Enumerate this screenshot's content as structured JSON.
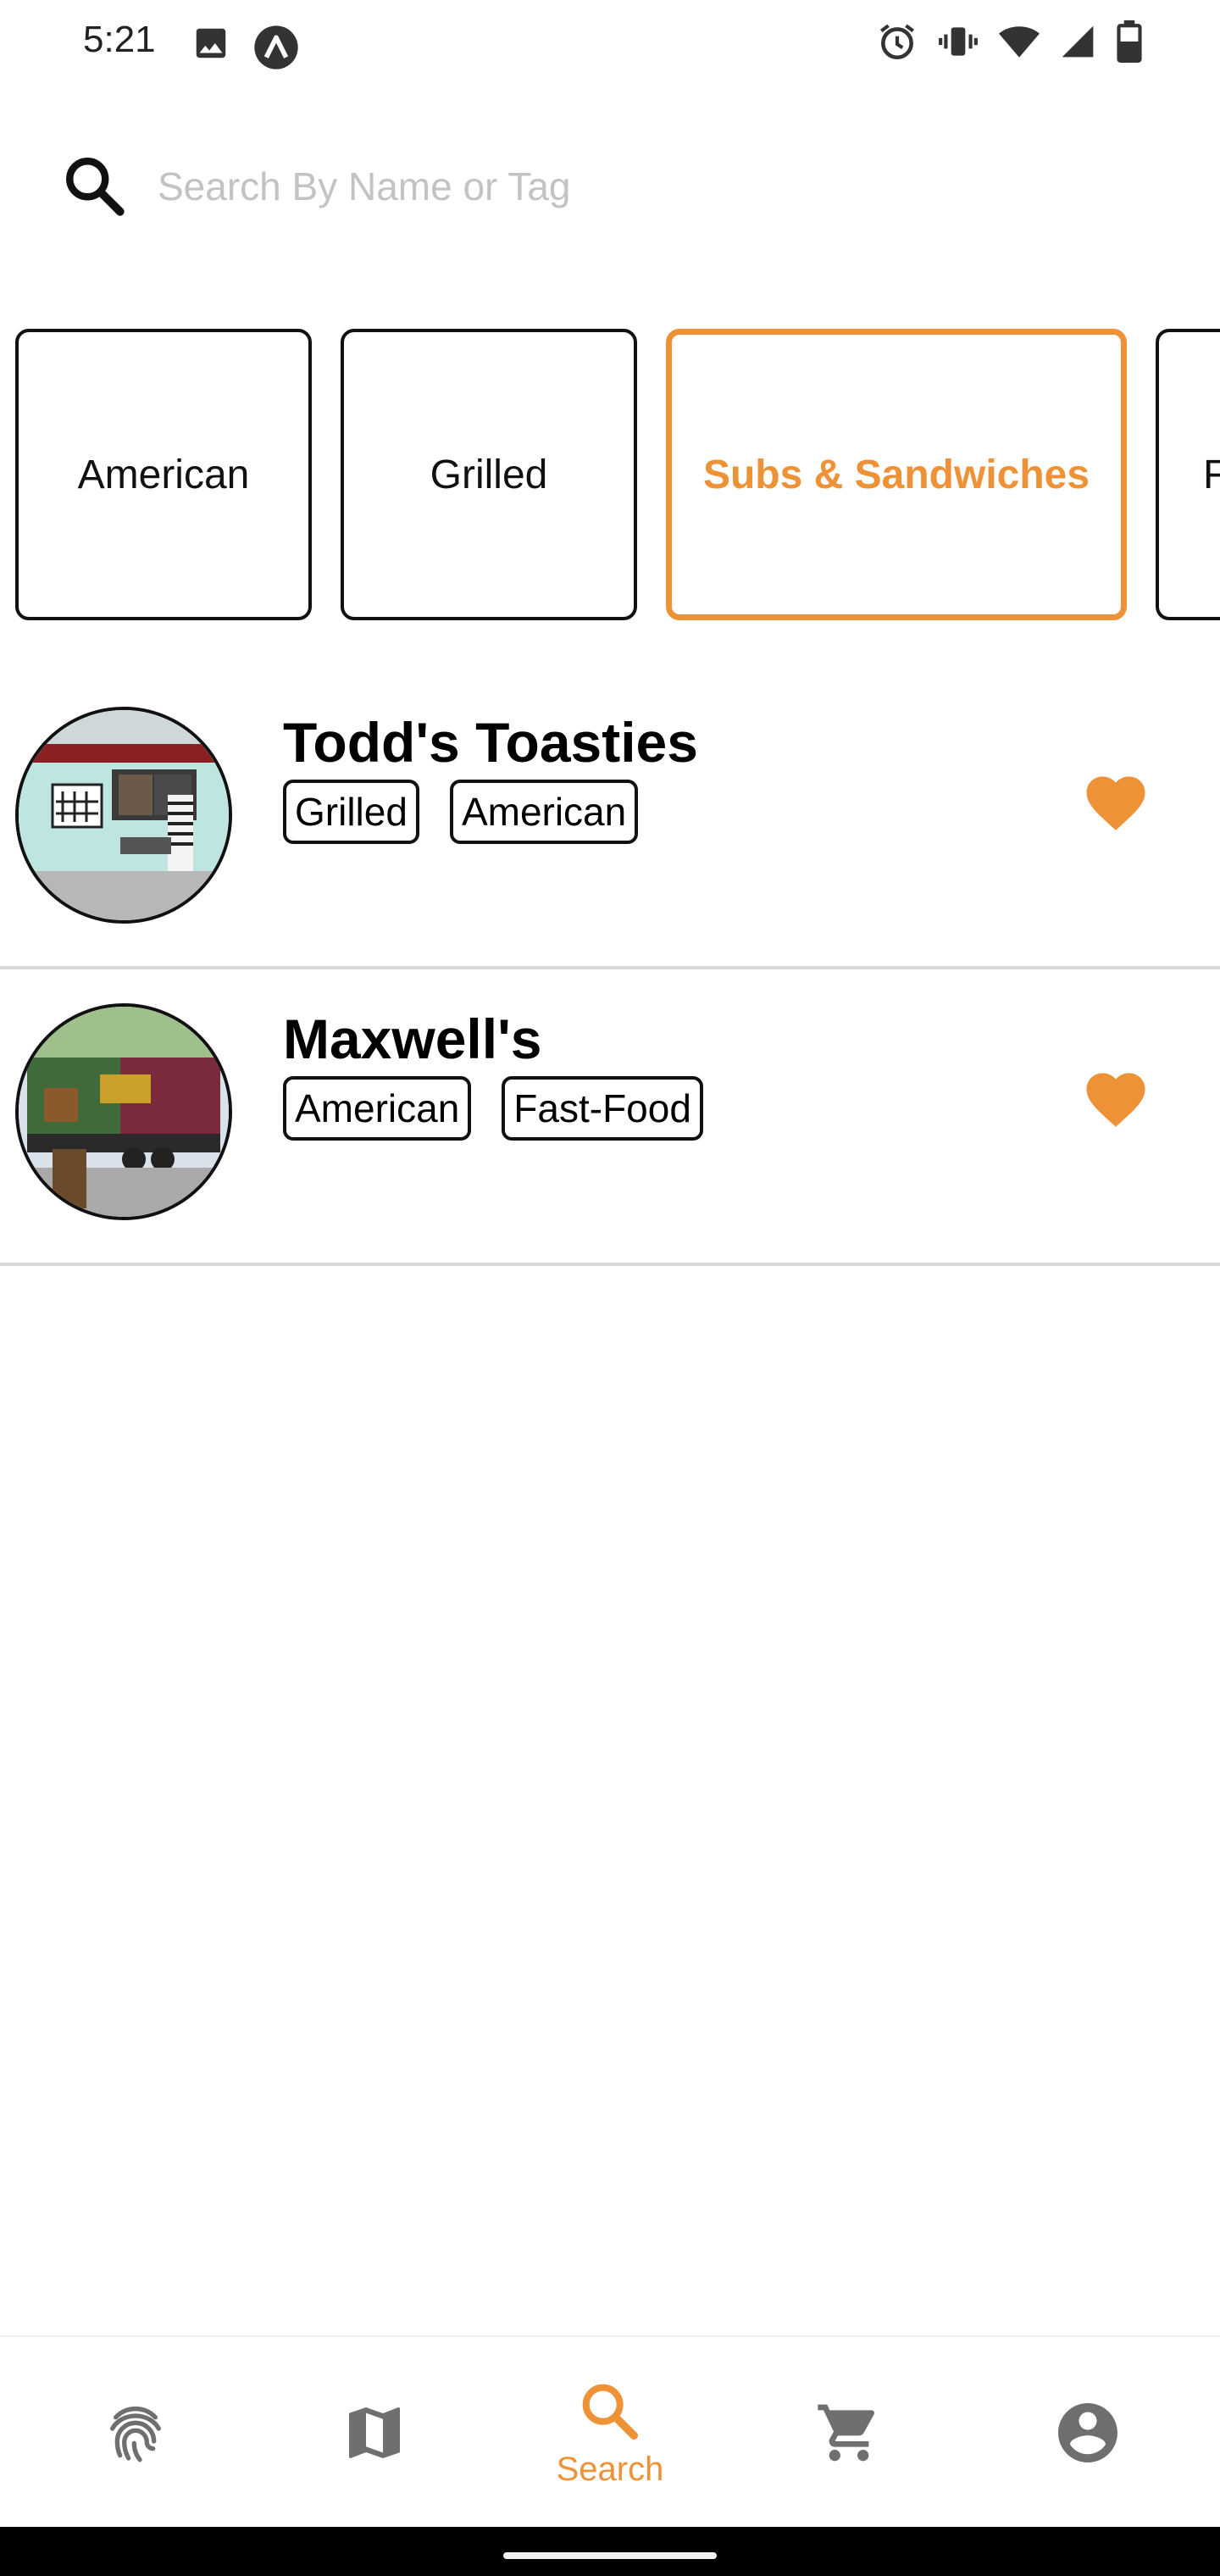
{
  "status_bar": {
    "time": "5:21",
    "left_icons": [
      "image-icon",
      "a-circle-icon"
    ],
    "right_icons": [
      "alarm-icon",
      "vibrate-icon",
      "wifi-icon",
      "signal-icon",
      "battery-icon"
    ]
  },
  "search": {
    "placeholder": "Search By Name or Tag",
    "value": ""
  },
  "categories": [
    {
      "label": "American",
      "selected": false
    },
    {
      "label": "Grilled",
      "selected": false
    },
    {
      "label": "Subs & Sandwiches",
      "selected": true
    },
    {
      "label": "F",
      "selected": false
    }
  ],
  "trucks": [
    {
      "name": "Todd's Toasties",
      "tags": [
        "Grilled",
        "American"
      ],
      "favorite": true
    },
    {
      "name": "Maxwell's",
      "tags": [
        "American",
        "Fast-Food"
      ],
      "favorite": true
    }
  ],
  "bottom_nav": [
    {
      "icon": "fingerprint-icon",
      "label": "",
      "active": false
    },
    {
      "icon": "map-icon",
      "label": "",
      "active": false
    },
    {
      "icon": "search-icon",
      "label": "Search",
      "active": true
    },
    {
      "icon": "cart-icon",
      "label": "",
      "active": false
    },
    {
      "icon": "account-icon",
      "label": "",
      "active": false
    }
  ],
  "colors": {
    "accent": "#ee9238",
    "border": "#111111",
    "divider": "#d8d8d8",
    "inactive_icon": "#6f6f6f"
  }
}
